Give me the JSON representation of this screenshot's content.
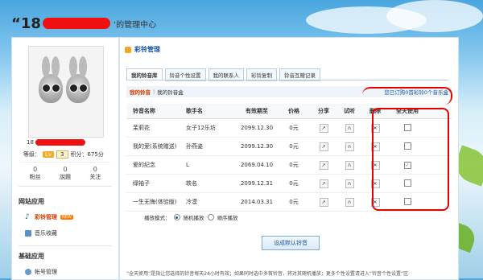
{
  "header": {
    "prefix": "“18",
    "suffix": "’的管理中心"
  },
  "sidebar": {
    "username_prefix": "18",
    "level_label": "等级：",
    "level_tag": "Lv",
    "level_value": "3",
    "points_label": "积分：675分",
    "stats": [
      {
        "value": "0",
        "label": "粉丝"
      },
      {
        "value": "0",
        "label": "說題"
      },
      {
        "value": "0",
        "label": "关注"
      }
    ],
    "section_apps": "网站应用",
    "app_items": [
      {
        "label": "彩铃管理",
        "badge": "NEW"
      },
      {
        "label": "音乐收藏"
      }
    ],
    "section_basic": "基础应用",
    "basic_items": [
      {
        "label": "帐号管理"
      }
    ]
  },
  "main": {
    "title": "彩铃管理",
    "tabs": [
      "我的铃音库",
      "铃音个性设置",
      "我的联系人",
      "彩铃复制",
      "铃音互赠记录"
    ],
    "subnav": {
      "current": "我的铃音",
      "other": "我的铃音盒",
      "info": "您已订购0首彩铃0个音乐盒"
    },
    "columns": [
      "铃音名称",
      "歌手名",
      "有效期至",
      "价格",
      "分享",
      "试听",
      "删除",
      "全天使用"
    ],
    "rows": [
      {
        "name": "茉莉花",
        "singer": "女子12乐坊",
        "expire": "2099.12.30",
        "price": "0元",
        "checked": false
      },
      {
        "name": "我的爱(系统赠送)",
        "singer": "孙燕姿",
        "expire": "2099.12.30",
        "price": "0元",
        "checked": false
      },
      {
        "name": "爱的纪念",
        "singer": "L",
        "expire": "2069.04.10",
        "price": "0元",
        "checked": true
      },
      {
        "name": "绿袖子",
        "singer": "轶名",
        "expire": "2099.12.31",
        "price": "0元",
        "checked": false
      },
      {
        "name": "一生无悔(体验版)",
        "singer": "冷漠",
        "expire": "2014.03.31",
        "price": "0元",
        "checked": false
      }
    ],
    "play_mode_label": "播放模式：",
    "play_modes": [
      {
        "label": "随机播放",
        "selected": true
      },
      {
        "label": "顺序播放",
        "selected": false
      }
    ],
    "save_label": "设成默认铃音",
    "note": "“全天使用”是指让您选择的铃音每天24小时有效；如果同时选中多首铃音，将对其随机播放；更多个性设置请进入“铃音个性设置”区"
  },
  "colors": {
    "accent": "#d63b00",
    "link": "#1a56a0",
    "annotation": "#e60000"
  }
}
